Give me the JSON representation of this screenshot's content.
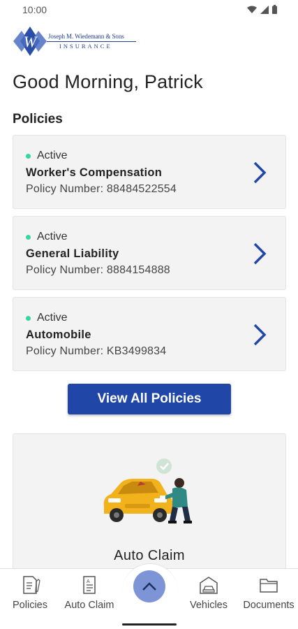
{
  "status_bar": {
    "time": "10:00"
  },
  "logo": {
    "top_text": "Joseph M. Wiedemann & Sons",
    "bottom_text": "INSURANCE"
  },
  "greeting": "Good Morning, Patrick",
  "policies_section": {
    "title": "Policies",
    "items": [
      {
        "status": "Active",
        "name": "Worker's Compensation",
        "number": "Policy Number: 88484522554"
      },
      {
        "status": "Active",
        "name": "General Liability",
        "number": "Policy Number: 8884154888"
      },
      {
        "status": "Active",
        "name": "Automobile",
        "number": "Policy Number: KB3499834"
      }
    ],
    "view_all_label": "View All Policies"
  },
  "claim_card": {
    "title": "Auto Claim"
  },
  "bottom_nav": {
    "items": [
      {
        "label": "Policies",
        "icon": "policies-document-icon"
      },
      {
        "label": "Auto Claim",
        "icon": "auto-claim-form-icon"
      },
      {
        "label": "Vehicles",
        "icon": "vehicles-garage-icon"
      },
      {
        "label": "Documents",
        "icon": "documents-folder-icon"
      }
    ],
    "fab_icon": "chevron-up-icon"
  },
  "colors": {
    "primary": "#2046a8",
    "status_active": "#36d6a2",
    "card_bg": "#f3f3f4",
    "fab": "#7d95d6"
  }
}
